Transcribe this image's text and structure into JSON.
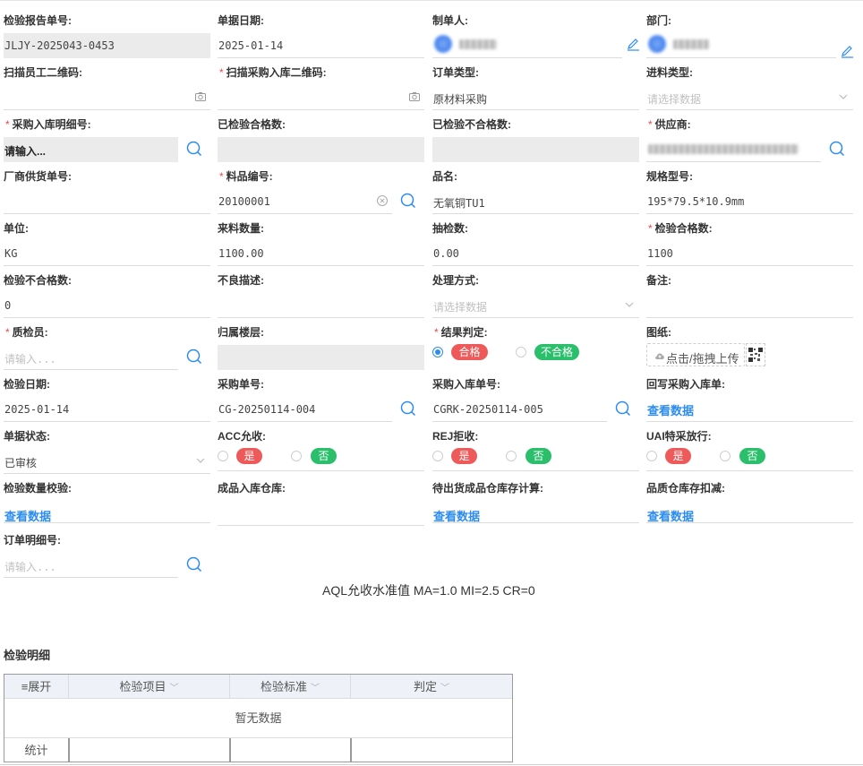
{
  "form": {
    "report_no": {
      "label": "检验报告单号:",
      "value": "JLJY-2025043-0453"
    },
    "doc_date": {
      "label": "单据日期:",
      "value": "2025-01-14"
    },
    "maker": {
      "label": "制单人:"
    },
    "dept": {
      "label": "部门:"
    },
    "scan_employee": {
      "label": "扫描员工二维码:"
    },
    "scan_purchase": {
      "label": "扫描采购入库二维码:"
    },
    "order_type": {
      "label": "订单类型:",
      "value": "原材料采购"
    },
    "material_type": {
      "label": "进料类型:",
      "placeholder": "请选择数据"
    },
    "purchase_detail_no": {
      "label": "采购入库明细号:",
      "value": "请输入..."
    },
    "passed_count": {
      "label": "已检验合格数:"
    },
    "failed_count": {
      "label": "已检验不合格数:"
    },
    "supplier": {
      "label": "供应商:"
    },
    "vendor_delivery_no": {
      "label": "厂商供货单号:"
    },
    "material_code": {
      "label": "料品编号:",
      "value": "20100001"
    },
    "product_name": {
      "label": "品名:",
      "value": "无氧铜TU1"
    },
    "spec": {
      "label": "规格型号:",
      "value": "195*79.5*10.9mm"
    },
    "unit": {
      "label": "单位:",
      "value": "KG"
    },
    "incoming_qty": {
      "label": "来料数量:",
      "value": "1100.00"
    },
    "sample_qty": {
      "label": "抽检数:",
      "value": "0.00"
    },
    "pass_qty": {
      "label": "检验合格数:",
      "value": "1100"
    },
    "fail_qty": {
      "label": "检验不合格数:",
      "value": "0"
    },
    "defect_desc": {
      "label": "不良描述:"
    },
    "handling": {
      "label": "处理方式:",
      "placeholder": "请选择数据"
    },
    "remark": {
      "label": "备注:"
    },
    "inspector": {
      "label": "质检员:",
      "placeholder": "请输入..."
    },
    "floor": {
      "label": "归属楼层:"
    },
    "result": {
      "label": "结果判定:",
      "pass": "合格",
      "fail": "不合格"
    },
    "drawing": {
      "label": "图纸:",
      "upload": "点击/拖拽上传"
    },
    "inspect_date": {
      "label": "检验日期:",
      "value": "2025-01-14"
    },
    "purchase_no": {
      "label": "采购单号:",
      "value": "CG-20250114-004"
    },
    "purchase_in_no": {
      "label": "采购入库单号:",
      "value": "CGRK-20250114-005"
    },
    "writeback": {
      "label": "回写采购入库单:",
      "link": "查看数据"
    },
    "doc_status": {
      "label": "单据状态:",
      "value": "已审核"
    },
    "acc": {
      "label": "ACC允收:",
      "yes": "是",
      "no": "否"
    },
    "rej": {
      "label": "REJ拒收:",
      "yes": "是",
      "no": "否"
    },
    "uai": {
      "label": "UAI特采放行:",
      "yes": "是",
      "no": "否"
    },
    "qty_check": {
      "label": "检验数量校验:",
      "link": "查看数据"
    },
    "finished_wh": {
      "label": "成品入库仓库:"
    },
    "pending_stock": {
      "label": "待出货成品仓库存计算:",
      "link": "查看数据"
    },
    "quality_wh": {
      "label": "品质仓库存扣减:",
      "link": "查看数据"
    },
    "order_detail_no": {
      "label": "订单明细号:",
      "placeholder": "请输入..."
    }
  },
  "aql_text": "AQL允收水准值 MA=1.0 MI=2.5 CR=0",
  "detail": {
    "title": "检验明细",
    "columns": [
      "≡展开",
      "检验项目",
      "检验标准",
      "判定"
    ],
    "empty": "暂无数据",
    "footer": "统计"
  },
  "colors": {
    "accent": "#2d8cf0",
    "pass_tag": "#ee5a5a",
    "fail_tag": "#2bbf6b",
    "required": "#e64a4a"
  }
}
